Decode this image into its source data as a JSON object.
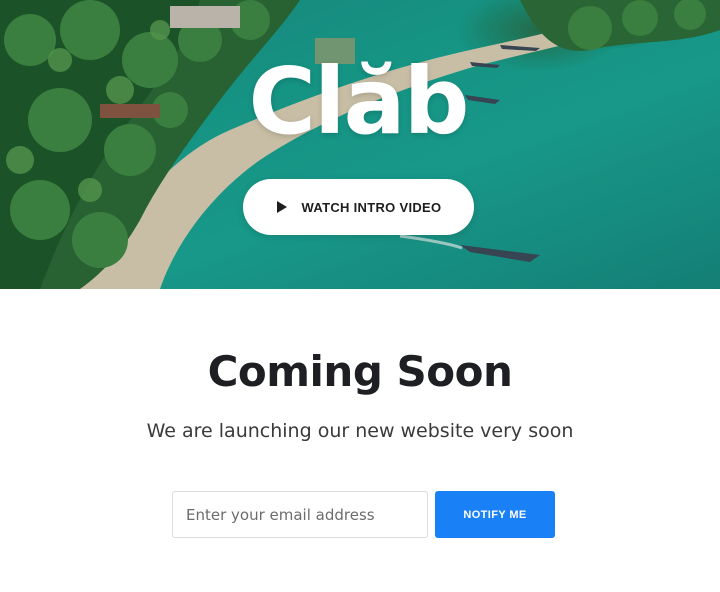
{
  "hero": {
    "logo_text": "Clăb",
    "video_button_label": "WATCH INTRO VIDEO",
    "play_icon": "play-icon"
  },
  "main": {
    "title": "Coming Soon",
    "subtitle": "We are launching our new website very soon"
  },
  "subscribe": {
    "email_placeholder": "Enter your email address",
    "email_value": "",
    "button_label": "NOTIFY ME"
  },
  "colors": {
    "accent": "#1a80f5",
    "sea": "#17a08f",
    "title": "#1e1f22"
  }
}
